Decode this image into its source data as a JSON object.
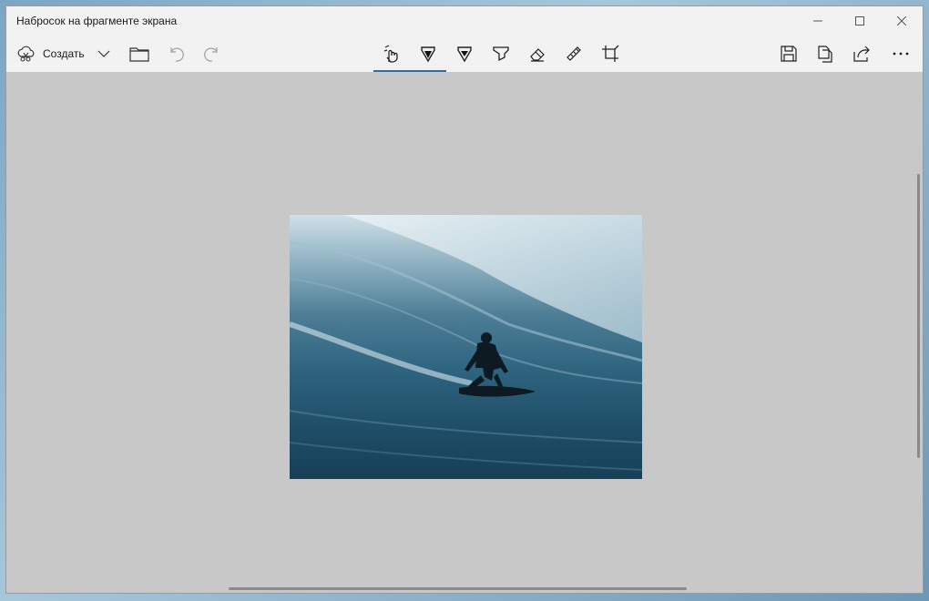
{
  "window": {
    "title": "Набросок на фрагменте экрана"
  },
  "caption_buttons": {
    "minimize": "minimize-icon",
    "maximize": "maximize-icon",
    "close": "close-icon"
  },
  "toolbar": {
    "new_label": "Создать",
    "left_icons": [
      "new-snip-icon",
      "chevron-down-icon",
      "folder-icon",
      "undo-icon",
      "redo-icon"
    ],
    "center_tools": [
      "touch-writing-icon",
      "ballpoint-pen-icon",
      "pencil-icon",
      "highlighter-icon",
      "eraser-icon",
      "ruler-icon",
      "crop-icon"
    ],
    "active_tool": "ballpoint-pen-icon",
    "right_icons": [
      "save-icon",
      "copy-icon",
      "share-icon",
      "more-icon"
    ]
  },
  "colors": {
    "accent": "#2b6ea8",
    "canvas": "#c8c8c8",
    "chrome": "#f2f2f2"
  },
  "canvas": {
    "image": "surfer-on-wave"
  }
}
